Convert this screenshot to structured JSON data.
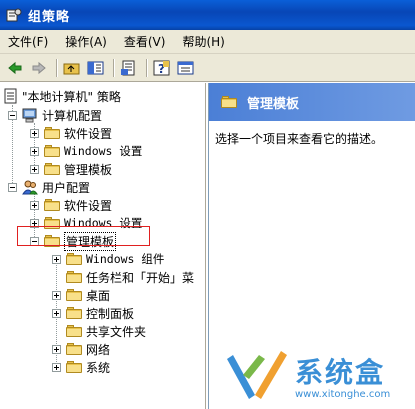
{
  "window": {
    "title": "组策略"
  },
  "menu": [
    "文件(F)",
    "操作(A)",
    "查看(V)",
    "帮助(H)"
  ],
  "toolbar": {
    "icons": [
      "back-icon",
      "forward-icon",
      "up-folder-icon",
      "show-hide-tree-icon",
      "export-list-icon",
      "help-icon",
      "properties-icon"
    ]
  },
  "tree": {
    "root": "\"本地计算机\" 策略",
    "computer_config": "计算机配置",
    "cc_software": "软件设置",
    "cc_windows": "Windows 设置",
    "cc_admin": "管理模板",
    "user_config": "用户配置",
    "uc_software": "软件设置",
    "uc_windows": "Windows 设置",
    "uc_admin": "管理模板",
    "uc_admin_children": [
      "Windows 组件",
      "任务栏和「开始」菜",
      "桌面",
      "控制面板",
      "共享文件夹",
      "网络",
      "系统"
    ]
  },
  "right_pane": {
    "header": "管理模板",
    "description": "选择一个项目来查看它的描述。"
  },
  "watermark": {
    "brand": "系统盒",
    "url": "www.xitonghe.com"
  }
}
